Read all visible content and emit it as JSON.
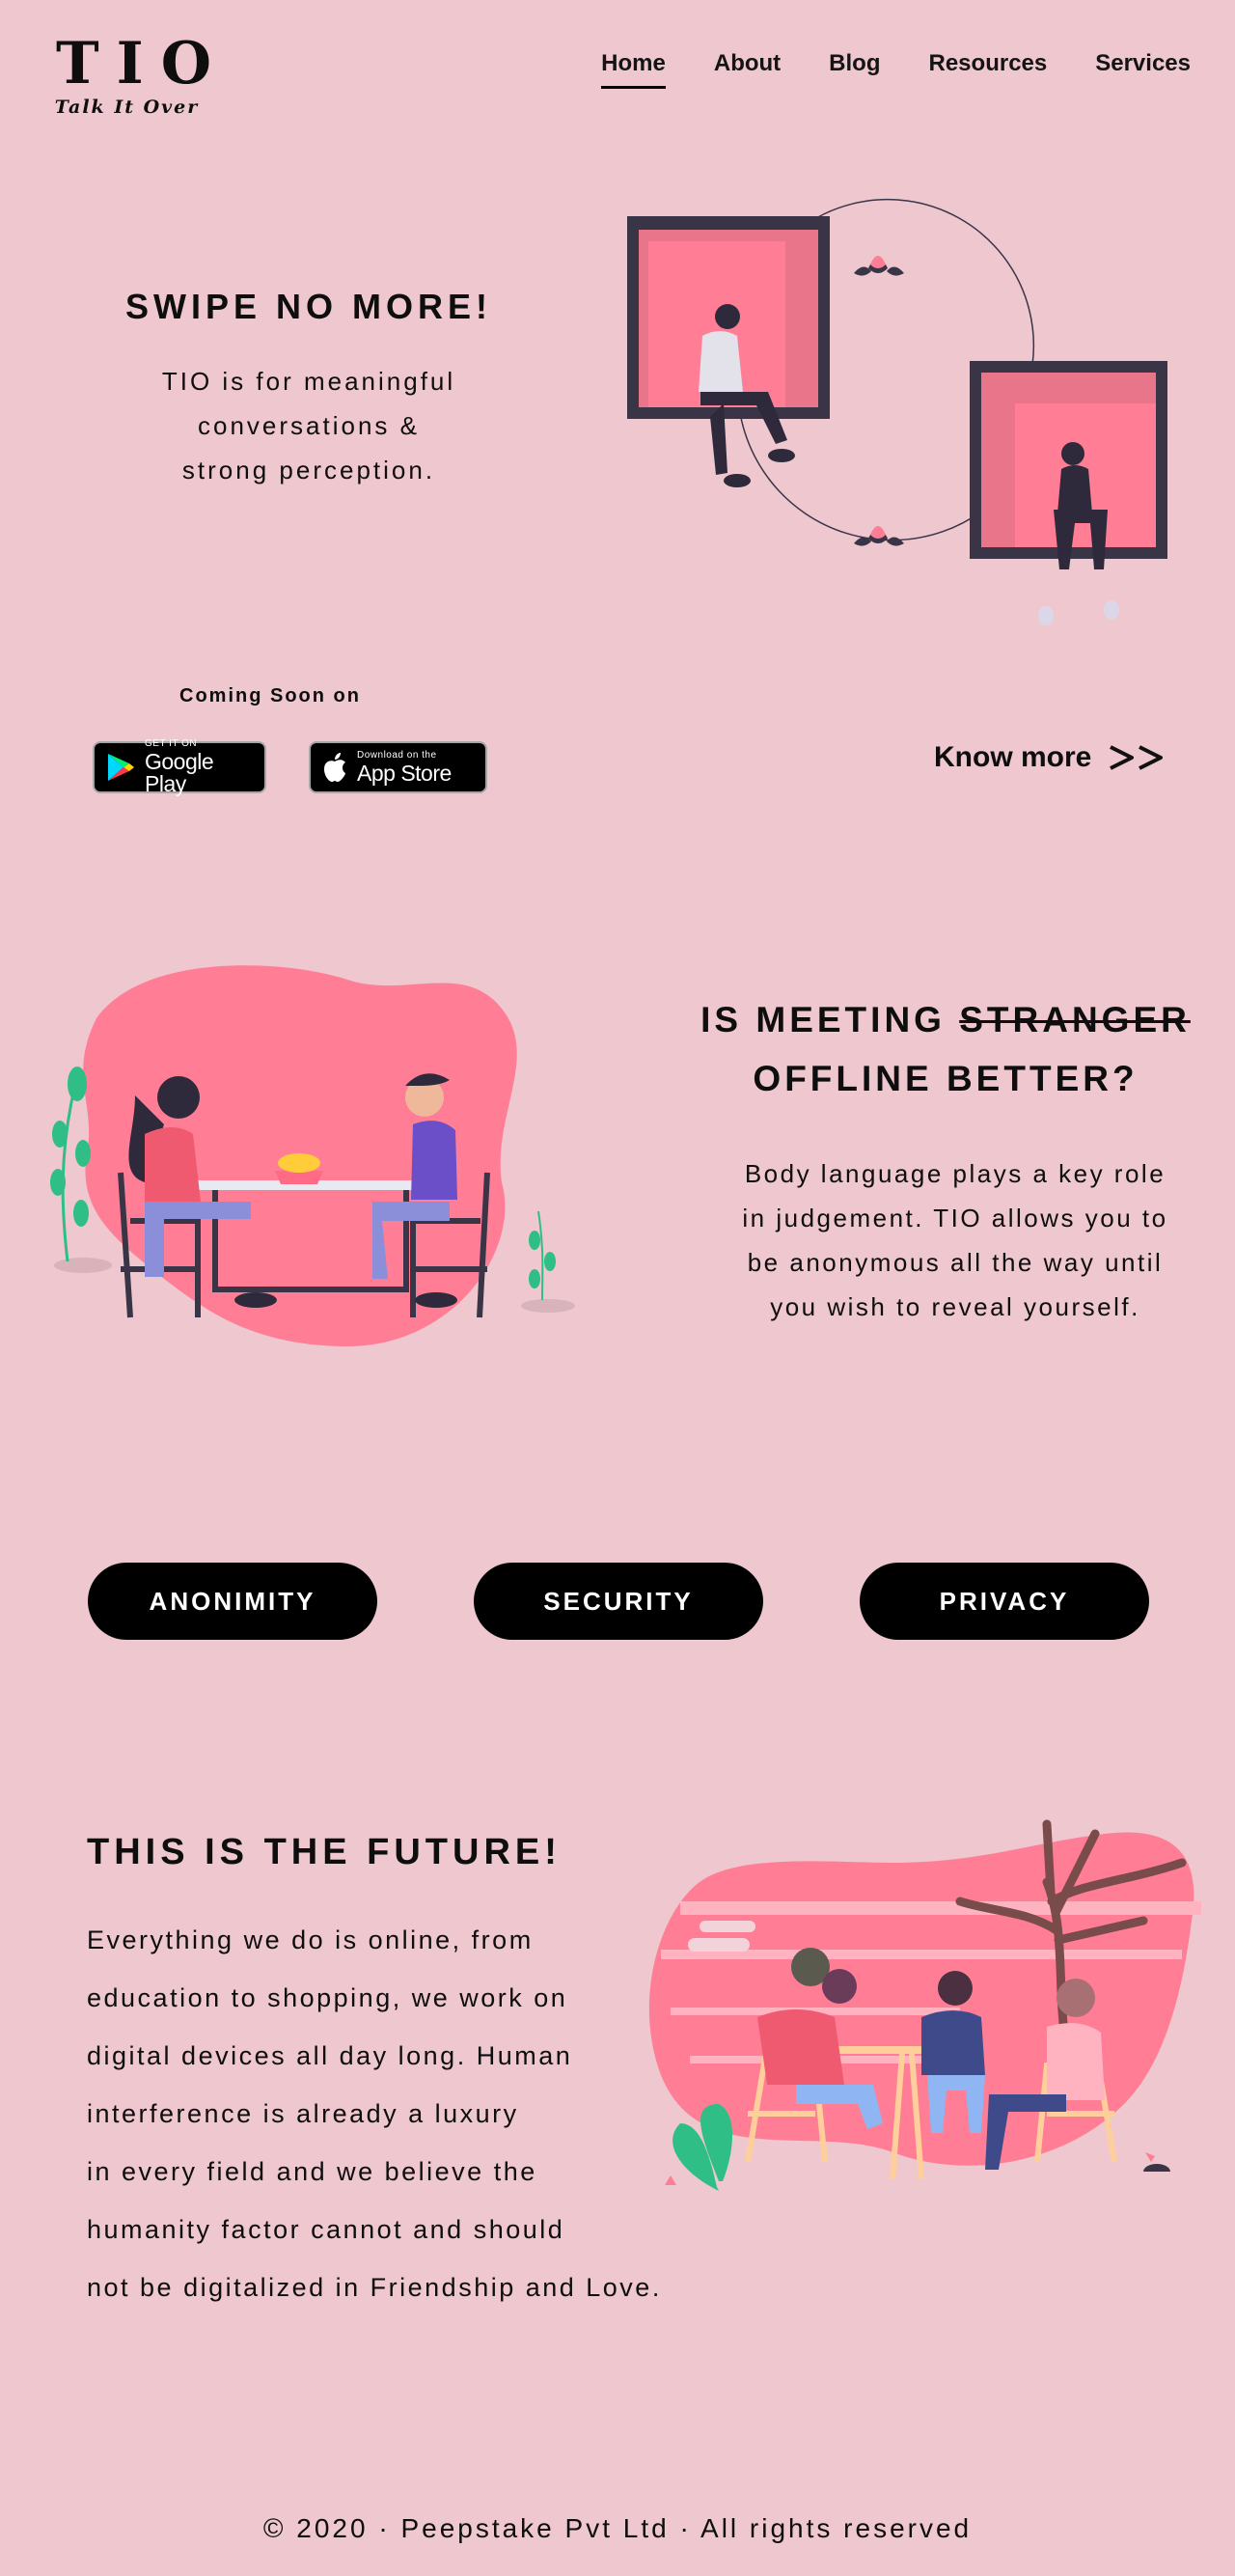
{
  "brand": {
    "title": "TIO",
    "tagline": "Talk It Over"
  },
  "nav": {
    "items": [
      {
        "label": "Home",
        "active": true
      },
      {
        "label": "About",
        "active": false
      },
      {
        "label": "Blog",
        "active": false
      },
      {
        "label": "Resources",
        "active": false
      },
      {
        "label": "Services",
        "active": false
      }
    ]
  },
  "hero": {
    "heading": "SWIPE NO MORE!",
    "subtext_lines": [
      "TIO is for meaningful",
      "conversations &",
      "strong perception."
    ],
    "coming_soon": "Coming Soon on",
    "google_play": {
      "small": "GET IT ON",
      "big": "Google Play"
    },
    "app_store": {
      "small": "Download on the",
      "big": "App Store"
    },
    "know_more": "Know more"
  },
  "meeting": {
    "heading_prefix": "IS MEETING ",
    "heading_struck": "STRANGER",
    "heading_line2": "OFFLINE BETTER?",
    "body_lines": [
      "Body language plays a key role",
      "in judgement. TIO allows you to",
      "be anonymous all the way until",
      "you wish to reveal yourself."
    ]
  },
  "features": [
    "ANONIMITY",
    "SECURITY",
    "PRIVACY"
  ],
  "future": {
    "heading": "THIS IS THE FUTURE!",
    "body_lines": [
      "Everything we do is online, from",
      "education to shopping, we work on",
      "digital devices all day long. Human",
      "interference is already a luxury",
      "in every field and we believe the",
      "humanity factor cannot and should",
      "not be digitalized in Friendship and Love."
    ]
  },
  "footer": {
    "text": "© 2020 · Peepstake Pvt Ltd · All rights reserved"
  },
  "colors": {
    "background": "#eec7cf",
    "accent_pink": "#ff7e95",
    "dark": "#3a3447",
    "text": "#0e0e0e"
  }
}
